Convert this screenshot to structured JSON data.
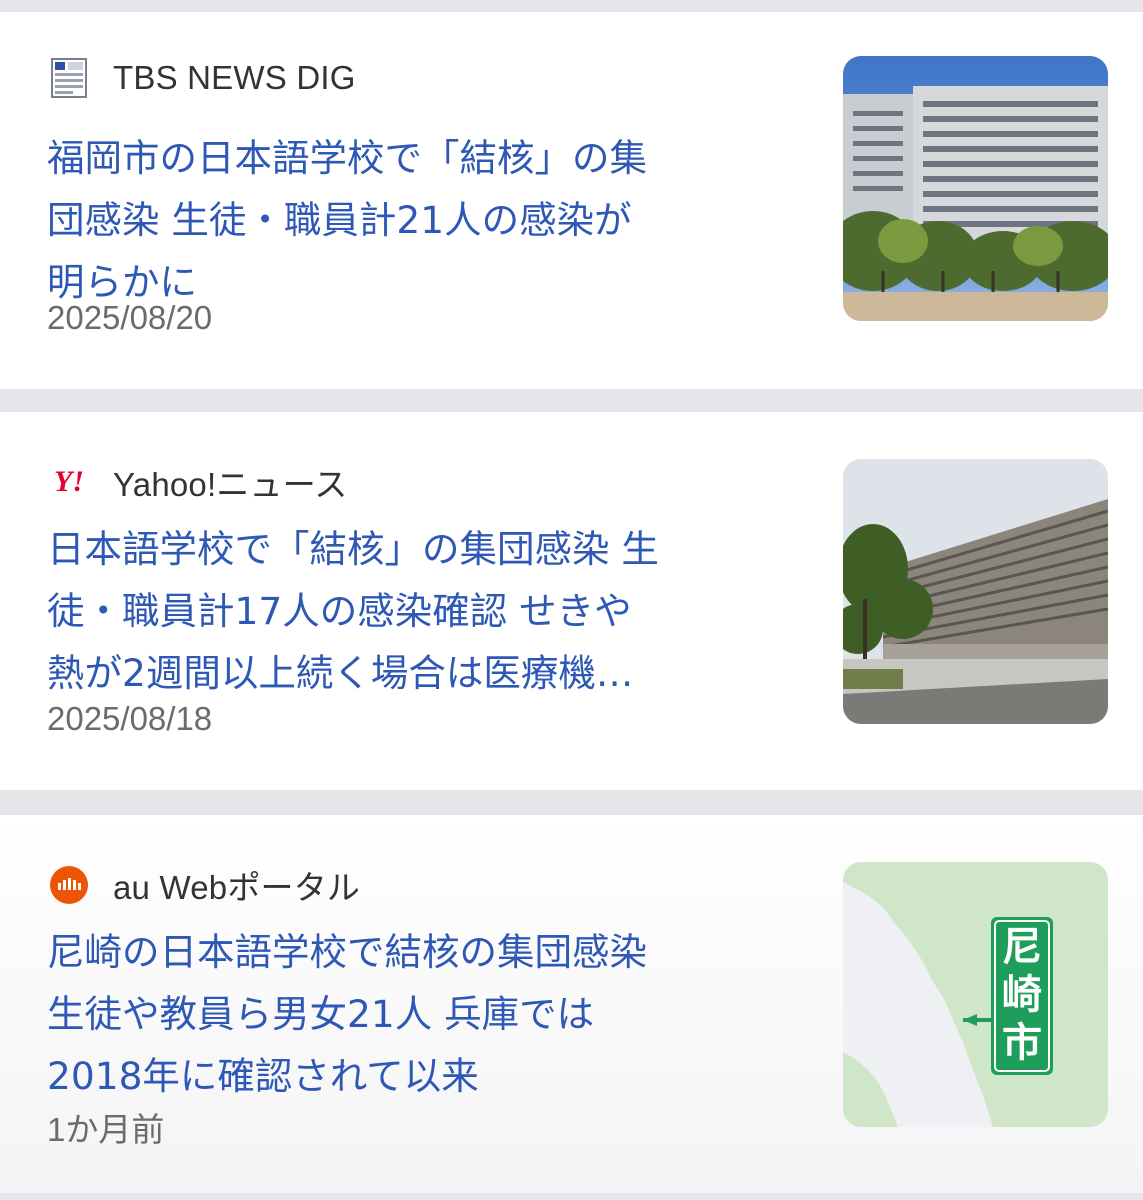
{
  "articles": [
    {
      "source": {
        "name": "TBS NEWS DIG",
        "icon": "tbs-news-dig-logo-icon"
      },
      "headline_lines": [
        "福岡市の日本語学校で「結核」の集",
        "団感染 生徒・職員計21人の感染が",
        "明らかに"
      ],
      "date": "2025/08/20",
      "thumbnail": "office-building-photo"
    },
    {
      "source": {
        "name": "Yahoo!ニュース",
        "icon": "yahoo-news-logo-icon",
        "icon_text": "Y!"
      },
      "headline_lines": [
        "日本語学校で「結核」の集団感染 生",
        "徒・職員計17人の感染確認 せきや",
        "熱が2週間以上続く場合は医療機…"
      ],
      "date": "2025/08/18",
      "thumbnail": "government-building-photo"
    },
    {
      "source": {
        "name": "au Webポータル",
        "icon": "au-web-portal-logo-icon"
      },
      "headline_lines": [
        "尼崎の日本語学校で結核の集団感染",
        "生徒や教員ら男女21人 兵庫では",
        "2018年に確認されて以来"
      ],
      "date": "1か月前",
      "thumbnail": "amagasaki-map",
      "thumbnail_label": [
        "尼",
        "崎",
        "市"
      ]
    }
  ],
  "colors": {
    "headline": "#2e58b5",
    "meta_text": "#6b6b6b",
    "separator": "#e6e6ea",
    "yahoo_red": "#e60033",
    "au_orange": "#eb5505",
    "map_green": "#1e9e5a"
  }
}
